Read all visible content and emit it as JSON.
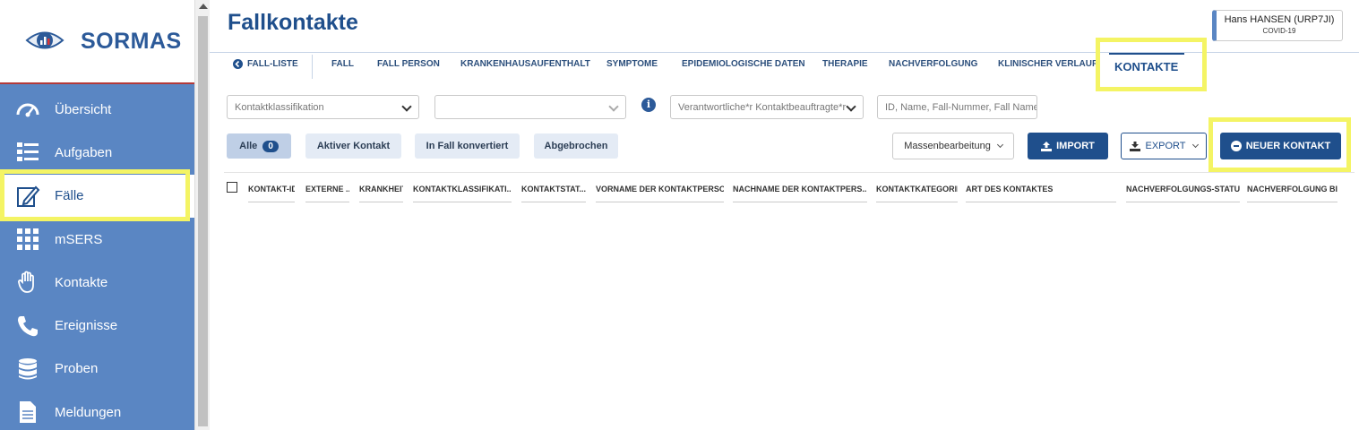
{
  "brand": {
    "name": "SORMAS"
  },
  "sidebar": {
    "items": [
      {
        "label": "Übersicht",
        "icon": "dashboard-icon"
      },
      {
        "label": "Aufgaben",
        "icon": "task-list-icon"
      },
      {
        "label": "Fälle",
        "icon": "edit-icon",
        "active": true
      },
      {
        "label": "mSERS",
        "icon": "grid-icon"
      },
      {
        "label": "Kontakte",
        "icon": "hand-icon"
      },
      {
        "label": "Ereignisse",
        "icon": "phone-icon"
      },
      {
        "label": "Proben",
        "icon": "database-icon"
      },
      {
        "label": "Meldungen",
        "icon": "document-icon"
      }
    ]
  },
  "header": {
    "title": "Fallkontakte",
    "user_name": "Hans HANSEN (URP7JI)",
    "user_disease": "COVID-19"
  },
  "tabs": {
    "back": "FALL-LISTE",
    "items": [
      "FALL",
      "FALL PERSON",
      "KRANKENHAUSAUFENTHALT",
      "SYMPTOME",
      "EPIDEMIOLOGISCHE DATEN",
      "THERAPIE",
      "NACHVERFOLGUNG",
      "KLINISCHER VERLAUF",
      "KONTAKTE"
    ],
    "active": "KONTAKTE"
  },
  "filters": {
    "classification_placeholder": "Kontaktklassifikation",
    "second_select": "",
    "officer_placeholder": "Verantwortliche*r Kontaktbeauftragte*r",
    "search_placeholder": "ID, Name, Fall-Nummer, Fall Name"
  },
  "status_filters": [
    {
      "label": "Alle",
      "count": "0"
    },
    {
      "label": "Aktiver Kontakt"
    },
    {
      "label": "In Fall konvertiert"
    },
    {
      "label": "Abgebrochen"
    }
  ],
  "actions": {
    "bulk_edit": "Massenbearbeitung",
    "import": "IMPORT",
    "export": "EXPORT",
    "new_contact": "NEUER KONTAKT"
  },
  "table": {
    "columns": [
      "KONTAKT-ID",
      "EXTERNE ...",
      "KRANKHEIT",
      "KONTAKTKLASSIFIKATI...",
      "KONTAKTSTAT...",
      "VORNAME DER KONTAKTPERSON",
      "NACHNAME DER KONTAKTPERS...",
      "KONTAKTKATEGORIE",
      "ART DES KONTAKTES",
      "NACHVERFOLGUNGS-STATUS",
      "NACHVERFOLGUNG BIS"
    ],
    "rows": []
  },
  "colors": {
    "primary": "#1f4f8c",
    "sidebar": "#5a86c3",
    "highlight": "#f4f464"
  }
}
